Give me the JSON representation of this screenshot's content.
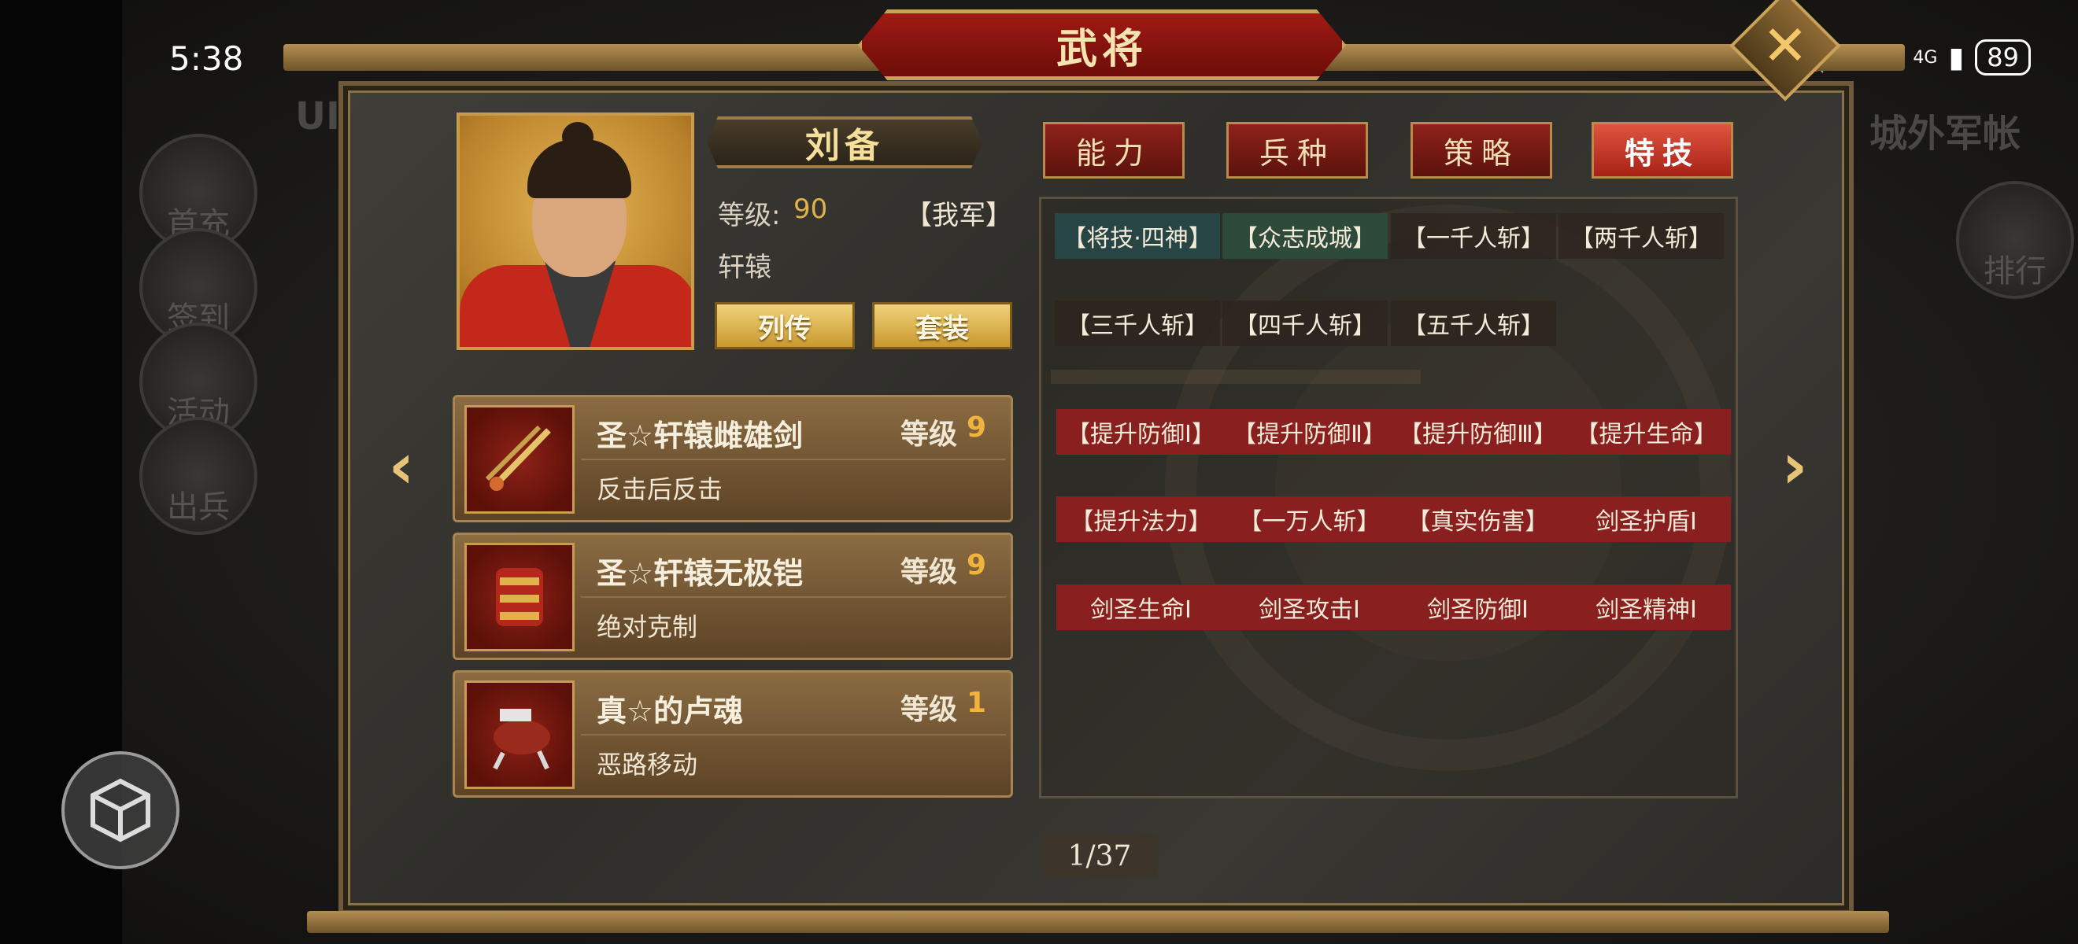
{
  "status_bar": {
    "time": "5:38",
    "battery": "89",
    "network": "4G"
  },
  "background": {
    "left_menu": [
      "首充",
      "签到",
      "活动",
      "出兵"
    ],
    "left_top_label": "UI",
    "right_title": "城外军帐",
    "right_menu": [
      "排行"
    ]
  },
  "dialog": {
    "title": "武将",
    "close_icon": "close-icon"
  },
  "general": {
    "name": "刘备",
    "level_label": "等级:",
    "level_value": "90",
    "faction": "【我军】",
    "subtitle": "轩辕",
    "buttons": [
      "列传",
      "套装"
    ]
  },
  "equipment": [
    {
      "name": "圣☆轩辕雌雄剑",
      "level_label": "等级",
      "level": "9",
      "desc": "反击后反击",
      "icon": "sword-icon"
    },
    {
      "name": "圣☆轩辕无极铠",
      "level_label": "等级",
      "level": "9",
      "desc": "绝对克制",
      "icon": "armor-icon"
    },
    {
      "name": "真☆的卢魂",
      "level_label": "等级",
      "level": "1",
      "desc": "恶路移动",
      "icon": "horse-icon"
    }
  ],
  "tabs": [
    {
      "label": "能力",
      "active": false
    },
    {
      "label": "兵种",
      "active": false
    },
    {
      "label": "策略",
      "active": false
    },
    {
      "label": "特技",
      "active": true
    }
  ],
  "skills": {
    "row1": [
      {
        "label": "【将技·四神】",
        "style": "teal"
      },
      {
        "label": "【众志成城】",
        "style": "green"
      },
      {
        "label": "【一千人斩】",
        "style": "dark"
      },
      {
        "label": "【两千人斩】",
        "style": "dark"
      }
    ],
    "row2": [
      {
        "label": "【三千人斩】",
        "style": "dark"
      },
      {
        "label": "【四千人斩】",
        "style": "dark"
      },
      {
        "label": "【五千人斩】",
        "style": "dark"
      }
    ],
    "row3": [
      {
        "label": "【提升防御Ⅰ】",
        "style": "red"
      },
      {
        "label": "【提升防御Ⅱ】",
        "style": "red"
      },
      {
        "label": "【提升防御Ⅲ】",
        "style": "red"
      },
      {
        "label": "【提升生命】",
        "style": "red"
      }
    ],
    "row4": [
      {
        "label": "【提升法力】",
        "style": "red"
      },
      {
        "label": "【一万人斩】",
        "style": "red"
      },
      {
        "label": "【真实伤害】",
        "style": "red"
      },
      {
        "label": "剑圣护盾Ⅰ",
        "style": "red"
      }
    ],
    "row5": [
      {
        "label": "剑圣生命Ⅰ",
        "style": "red"
      },
      {
        "label": "剑圣攻击Ⅰ",
        "style": "red"
      },
      {
        "label": "剑圣防御Ⅰ",
        "style": "red"
      },
      {
        "label": "剑圣精神Ⅰ",
        "style": "red"
      }
    ]
  },
  "pagination": {
    "text": "1/37"
  },
  "nav": {
    "prev_icon": "chevron-left-icon",
    "next_icon": "chevron-right-icon"
  },
  "colors": {
    "accent_gold": "#e2b24a",
    "tab_red": "#8e2219",
    "chip_red": "#8a1f1f"
  }
}
